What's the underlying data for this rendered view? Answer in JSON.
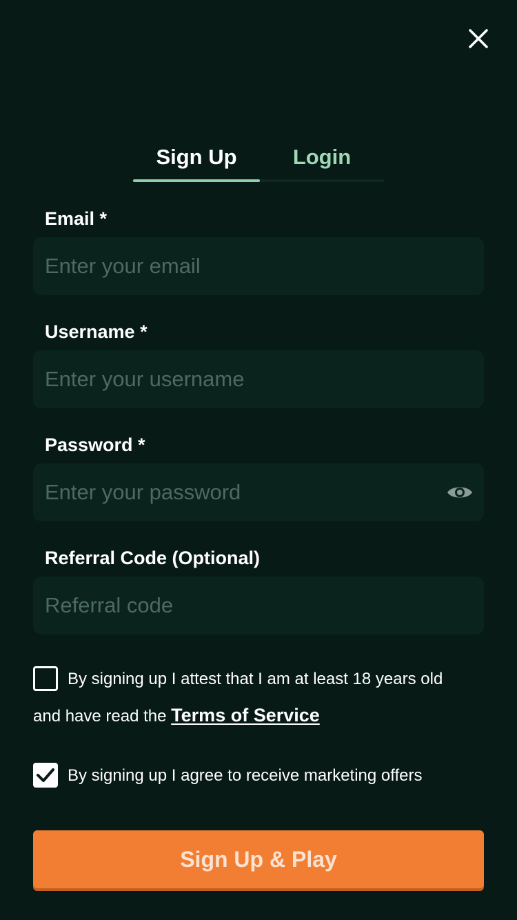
{
  "header": {
    "close_icon": "close-icon"
  },
  "tabs": {
    "signup_label": "Sign Up",
    "login_label": "Login",
    "active": "Sign Up"
  },
  "form": {
    "email": {
      "label": "Email *",
      "placeholder": "Enter your email",
      "value": ""
    },
    "username": {
      "label": "Username *",
      "placeholder": "Enter your username",
      "value": ""
    },
    "password": {
      "label": "Password *",
      "placeholder": "Enter your password",
      "value": "",
      "toggle_icon": "eye-icon"
    },
    "referral": {
      "label": "Referral Code (Optional)",
      "placeholder": "Referral code",
      "value": ""
    }
  },
  "consents": {
    "age": {
      "checked": false,
      "text_line1": "By signing up I attest that I am at least 18 years old",
      "text_line2_prefix": "and have read the",
      "link_label": "Terms of Service"
    },
    "marketing": {
      "checked": true,
      "text": "By signing up I agree to receive marketing offers"
    }
  },
  "cta": {
    "label": "Sign Up & Play"
  },
  "colors": {
    "background": "#071a16",
    "input_background": "#0a231d",
    "accent_green": "#8fd0aa",
    "cta_orange": "#f27e34"
  }
}
